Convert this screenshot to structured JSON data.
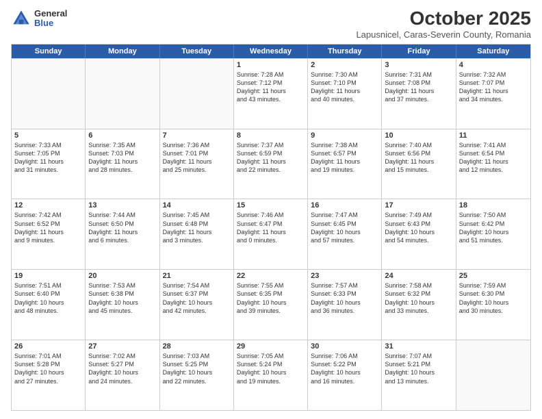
{
  "logo": {
    "general": "General",
    "blue": "Blue"
  },
  "header": {
    "month": "October 2025",
    "location": "Lapusnicel, Caras-Severin County, Romania"
  },
  "days": [
    "Sunday",
    "Monday",
    "Tuesday",
    "Wednesday",
    "Thursday",
    "Friday",
    "Saturday"
  ],
  "rows": [
    [
      {
        "day": "",
        "text": ""
      },
      {
        "day": "",
        "text": ""
      },
      {
        "day": "",
        "text": ""
      },
      {
        "day": "1",
        "text": "Sunrise: 7:28 AM\nSunset: 7:12 PM\nDaylight: 11 hours\nand 43 minutes."
      },
      {
        "day": "2",
        "text": "Sunrise: 7:30 AM\nSunset: 7:10 PM\nDaylight: 11 hours\nand 40 minutes."
      },
      {
        "day": "3",
        "text": "Sunrise: 7:31 AM\nSunset: 7:08 PM\nDaylight: 11 hours\nand 37 minutes."
      },
      {
        "day": "4",
        "text": "Sunrise: 7:32 AM\nSunset: 7:07 PM\nDaylight: 11 hours\nand 34 minutes."
      }
    ],
    [
      {
        "day": "5",
        "text": "Sunrise: 7:33 AM\nSunset: 7:05 PM\nDaylight: 11 hours\nand 31 minutes."
      },
      {
        "day": "6",
        "text": "Sunrise: 7:35 AM\nSunset: 7:03 PM\nDaylight: 11 hours\nand 28 minutes."
      },
      {
        "day": "7",
        "text": "Sunrise: 7:36 AM\nSunset: 7:01 PM\nDaylight: 11 hours\nand 25 minutes."
      },
      {
        "day": "8",
        "text": "Sunrise: 7:37 AM\nSunset: 6:59 PM\nDaylight: 11 hours\nand 22 minutes."
      },
      {
        "day": "9",
        "text": "Sunrise: 7:38 AM\nSunset: 6:57 PM\nDaylight: 11 hours\nand 19 minutes."
      },
      {
        "day": "10",
        "text": "Sunrise: 7:40 AM\nSunset: 6:56 PM\nDaylight: 11 hours\nand 15 minutes."
      },
      {
        "day": "11",
        "text": "Sunrise: 7:41 AM\nSunset: 6:54 PM\nDaylight: 11 hours\nand 12 minutes."
      }
    ],
    [
      {
        "day": "12",
        "text": "Sunrise: 7:42 AM\nSunset: 6:52 PM\nDaylight: 11 hours\nand 9 minutes."
      },
      {
        "day": "13",
        "text": "Sunrise: 7:44 AM\nSunset: 6:50 PM\nDaylight: 11 hours\nand 6 minutes."
      },
      {
        "day": "14",
        "text": "Sunrise: 7:45 AM\nSunset: 6:48 PM\nDaylight: 11 hours\nand 3 minutes."
      },
      {
        "day": "15",
        "text": "Sunrise: 7:46 AM\nSunset: 6:47 PM\nDaylight: 11 hours\nand 0 minutes."
      },
      {
        "day": "16",
        "text": "Sunrise: 7:47 AM\nSunset: 6:45 PM\nDaylight: 10 hours\nand 57 minutes."
      },
      {
        "day": "17",
        "text": "Sunrise: 7:49 AM\nSunset: 6:43 PM\nDaylight: 10 hours\nand 54 minutes."
      },
      {
        "day": "18",
        "text": "Sunrise: 7:50 AM\nSunset: 6:42 PM\nDaylight: 10 hours\nand 51 minutes."
      }
    ],
    [
      {
        "day": "19",
        "text": "Sunrise: 7:51 AM\nSunset: 6:40 PM\nDaylight: 10 hours\nand 48 minutes."
      },
      {
        "day": "20",
        "text": "Sunrise: 7:53 AM\nSunset: 6:38 PM\nDaylight: 10 hours\nand 45 minutes."
      },
      {
        "day": "21",
        "text": "Sunrise: 7:54 AM\nSunset: 6:37 PM\nDaylight: 10 hours\nand 42 minutes."
      },
      {
        "day": "22",
        "text": "Sunrise: 7:55 AM\nSunset: 6:35 PM\nDaylight: 10 hours\nand 39 minutes."
      },
      {
        "day": "23",
        "text": "Sunrise: 7:57 AM\nSunset: 6:33 PM\nDaylight: 10 hours\nand 36 minutes."
      },
      {
        "day": "24",
        "text": "Sunrise: 7:58 AM\nSunset: 6:32 PM\nDaylight: 10 hours\nand 33 minutes."
      },
      {
        "day": "25",
        "text": "Sunrise: 7:59 AM\nSunset: 6:30 PM\nDaylight: 10 hours\nand 30 minutes."
      }
    ],
    [
      {
        "day": "26",
        "text": "Sunrise: 7:01 AM\nSunset: 5:28 PM\nDaylight: 10 hours\nand 27 minutes."
      },
      {
        "day": "27",
        "text": "Sunrise: 7:02 AM\nSunset: 5:27 PM\nDaylight: 10 hours\nand 24 minutes."
      },
      {
        "day": "28",
        "text": "Sunrise: 7:03 AM\nSunset: 5:25 PM\nDaylight: 10 hours\nand 22 minutes."
      },
      {
        "day": "29",
        "text": "Sunrise: 7:05 AM\nSunset: 5:24 PM\nDaylight: 10 hours\nand 19 minutes."
      },
      {
        "day": "30",
        "text": "Sunrise: 7:06 AM\nSunset: 5:22 PM\nDaylight: 10 hours\nand 16 minutes."
      },
      {
        "day": "31",
        "text": "Sunrise: 7:07 AM\nSunset: 5:21 PM\nDaylight: 10 hours\nand 13 minutes."
      },
      {
        "day": "",
        "text": ""
      }
    ]
  ]
}
